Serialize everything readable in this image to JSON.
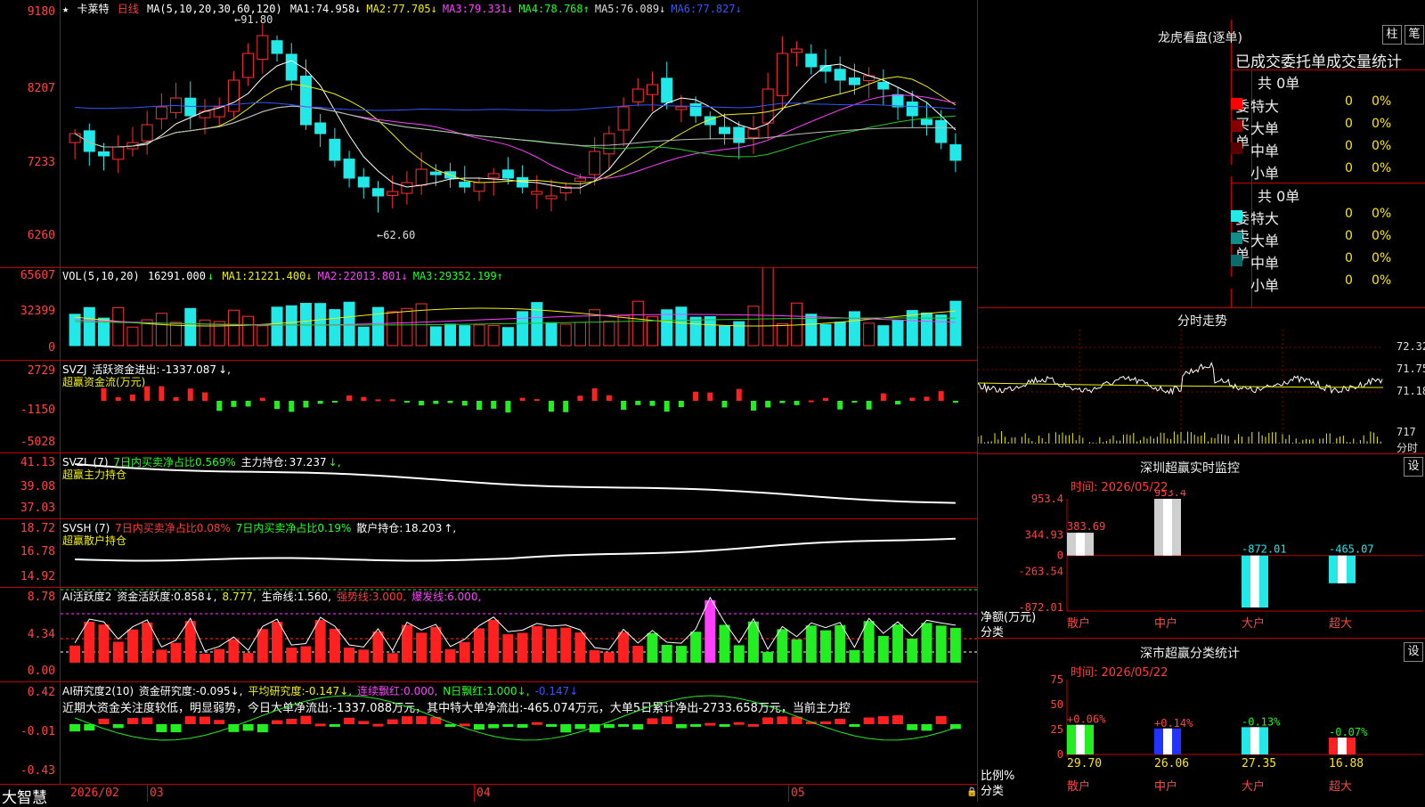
{
  "main": {
    "star_icon": "star-icon",
    "stock_name": "卡莱特",
    "period": "日线",
    "ma_params": "MA(5,10,20,30,60,120)",
    "ma": [
      {
        "label": "MA1:",
        "value": "74.958",
        "arrow": "↓",
        "color": "#ffffff"
      },
      {
        "label": "MA2:",
        "value": "77.705",
        "arrow": "↓",
        "color": "#f0f000"
      },
      {
        "label": "MA3:",
        "value": "79.331",
        "arrow": "↓",
        "color": "#ff40ff"
      },
      {
        "label": "MA4:",
        "value": "78.768",
        "arrow": "↑",
        "color": "#22ff22"
      },
      {
        "label": "MA5:",
        "value": "76.089",
        "arrow": "↓",
        "color": "#dddddd"
      },
      {
        "label": "MA6:",
        "value": "77.827",
        "arrow": "↓",
        "color": "#3355ff"
      }
    ],
    "y_labels": [
      "9180",
      "8207",
      "7233",
      "6260"
    ],
    "high_label": "91.80",
    "low_label": "62.60"
  },
  "vol": {
    "title": "VOL(5,10,20)",
    "value": "16291.000",
    "arrow": "↓",
    "ma": [
      {
        "label": "MA1:",
        "value": "21221.400",
        "arrow": "↓",
        "color": "#f0f000"
      },
      {
        "label": "MA2:",
        "value": "22013.801",
        "arrow": "↓",
        "color": "#ff40ff"
      },
      {
        "label": "MA3:",
        "value": "29352.199",
        "arrow": "↑",
        "color": "#22ff22"
      }
    ],
    "y_labels": [
      "65607",
      "32399",
      "0"
    ]
  },
  "svzj": {
    "title": "SVZJ",
    "label": "活跃资金进出:",
    "value": "-1337.087",
    "arrow": "↓,",
    "subtitle": "超赢资金流(万元)",
    "y_labels": [
      "2729",
      "-1150",
      "-5028"
    ]
  },
  "svzl": {
    "title": "SVZL (7)",
    "desc": "7日内买卖净占比0.569%",
    "label": "主力持仓:",
    "value": "37.237",
    "arrow": "↓,",
    "subtitle": "超赢主力持仓",
    "y_labels": [
      "41.13",
      "39.08",
      "37.03"
    ]
  },
  "svsh": {
    "title": "SVSH (7)",
    "desc1": "7日内买卖净占比0.08%",
    "desc2": "7日内买卖净占比0.19%",
    "label": "散户持仓:",
    "value": "18.203",
    "arrow": "↑,",
    "subtitle": "超赢散户持仓",
    "y_labels": [
      "18.72",
      "16.78",
      "14.92"
    ]
  },
  "ai1": {
    "title": "AI活跃度2",
    "items": [
      {
        "label": "资金活跃度:",
        "value": "0.858",
        "arrow": "↓,",
        "color": "#ffffff"
      },
      {
        "label": "",
        "value": "8.777,",
        "arrow": "",
        "color": "#f0f000"
      },
      {
        "label": "生命线:",
        "value": "1.560,",
        "arrow": "",
        "color": "#ffffff"
      },
      {
        "label": "强势线:",
        "value": "3.000,",
        "arrow": "",
        "color": "#ff3b3b"
      },
      {
        "label": "爆发线:",
        "value": "6.000,",
        "arrow": "",
        "color": "#ff40ff"
      }
    ],
    "y_labels": [
      "8.78",
      "4.34",
      "0.00"
    ]
  },
  "ai2": {
    "title": "AI研究度2(10)",
    "items": [
      {
        "label": "资金研究度:",
        "value": "-0.095",
        "arrow": "↓,",
        "color": "#ffffff"
      },
      {
        "label": "平均研究度:",
        "value": "-0.147",
        "arrow": "↓,",
        "color": "#f0f000"
      },
      {
        "label": "连续飘红:",
        "value": "0.000,",
        "arrow": "",
        "color": "#ff40ff"
      },
      {
        "label": "N日飘红:",
        "value": "1.000",
        "arrow": "↓,",
        "color": "#22ff22"
      },
      {
        "label": "",
        "value": "-0.147",
        "arrow": "↓",
        "color": "#3355ff"
      }
    ],
    "comment": "近期大资金关注度较低，明显弱势，今日大单净流出:-1337.088万元，其中特大单净流出:-465.074万元，大单5日累计净出-2733.658万元，当前主力控",
    "y_labels": [
      "0.42",
      "-0.01",
      "-0.43"
    ]
  },
  "xaxis": {
    "brand": "大智慧",
    "labels": [
      "2026/02",
      "03",
      "04",
      "05"
    ]
  },
  "right": {
    "lhb_title": "龙虎看盘(逐单)",
    "btn_bar": "柱",
    "btn_pen": "笔",
    "order_header": "已成交委托单成交量统计",
    "buy": {
      "side": "委买单",
      "total": "共 0单",
      "rows": [
        {
          "name": "特大",
          "color": "#ff0000",
          "count": "0",
          "pct": "0%"
        },
        {
          "name": "大单",
          "color": "#8a0000",
          "count": "0",
          "pct": "0%"
        },
        {
          "name": "中单",
          "color": "#5a0000",
          "count": "0",
          "pct": "0%"
        },
        {
          "name": "小单",
          "color": "#000000",
          "count": "0",
          "pct": "0%"
        }
      ]
    },
    "sell": {
      "side": "委卖单",
      "total": "共 0单",
      "rows": [
        {
          "name": "特大",
          "color": "#22e8e8",
          "count": "0",
          "pct": "0%"
        },
        {
          "name": "大单",
          "color": "#138c8c",
          "count": "0",
          "pct": "0%"
        },
        {
          "name": "中单",
          "color": "#0e6a6a",
          "count": "0",
          "pct": "0%"
        },
        {
          "name": "小单",
          "color": "#000000",
          "count": "0",
          "pct": "0%"
        }
      ]
    },
    "intraday": {
      "title": "分时走势",
      "y_labels": [
        "72.32",
        "71.75",
        "71.18"
      ],
      "vol_label": "717",
      "vol_unit": "分时"
    },
    "monitor": {
      "title": "深圳超赢实时监控",
      "settings": "设",
      "time": "时间: 2026/05/22",
      "y_labels": [
        "953.4",
        "344.93",
        "0",
        "-263.54",
        "-872.01"
      ],
      "bottom_label1": "净额(万元)",
      "bottom_label2": "分类",
      "categories": [
        "散户",
        "中户",
        "大户",
        "超大"
      ],
      "values": [
        383.69,
        953.4,
        -872.01,
        -465.07
      ],
      "value_labels": [
        "383.69",
        "953.4",
        "-872.01",
        "-465.07"
      ]
    },
    "classify": {
      "title": "深市超赢分类统计",
      "settings": "设",
      "time": "时间: 2026/05/22",
      "y_labels": [
        "75",
        "50",
        "25",
        "0"
      ],
      "bottom_label1": "比例%",
      "bottom_label2": "分类",
      "categories": [
        "散户",
        "中户",
        "大户",
        "超大"
      ],
      "values": [
        29.7,
        26.06,
        27.35,
        16.88
      ],
      "value_labels": [
        "29.70",
        "26.06",
        "27.35",
        "16.88"
      ],
      "changes": [
        "+0.06%",
        "+0.14%",
        "-0.13%",
        "-0.07%"
      ]
    }
  }
}
